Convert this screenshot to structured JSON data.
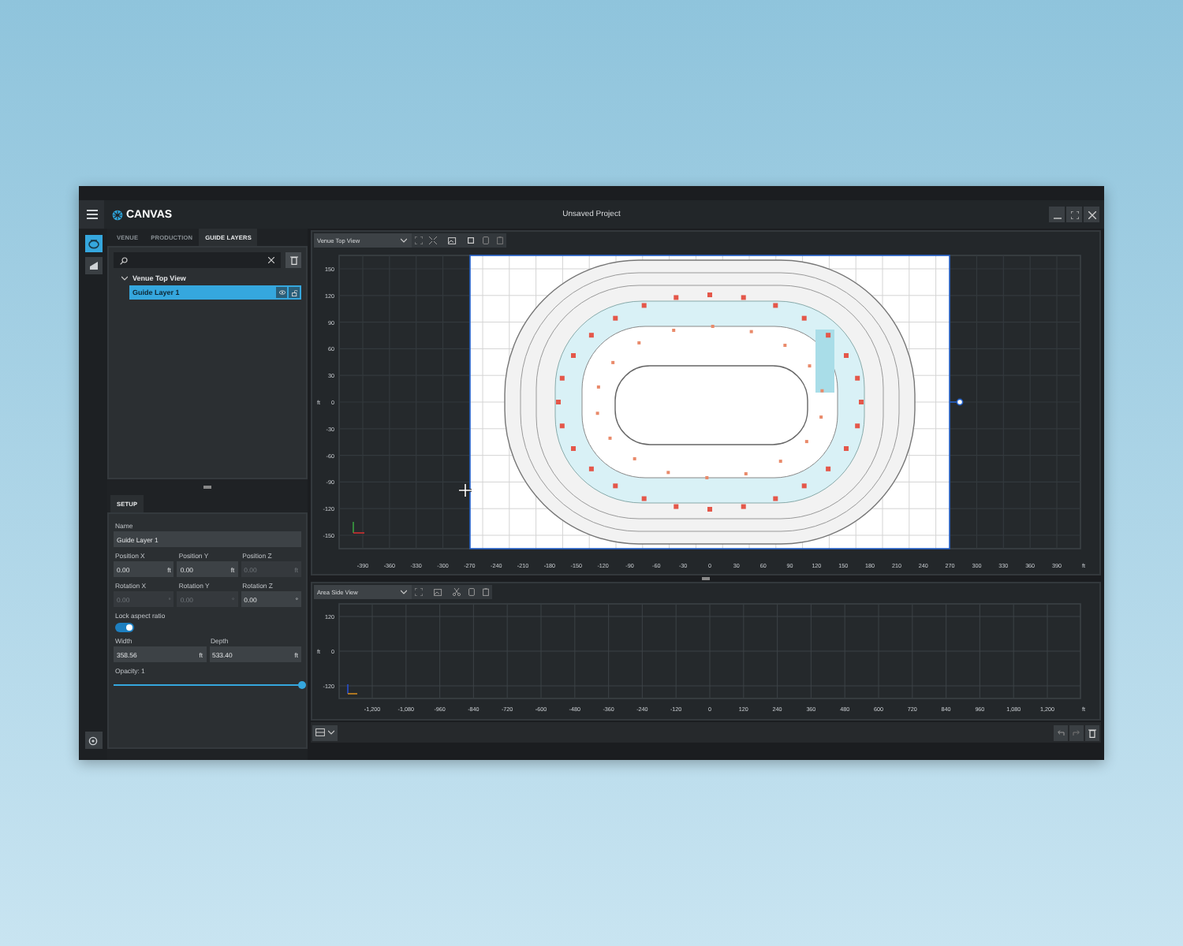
{
  "app": {
    "logo": "CANVAS"
  },
  "window": {
    "title": "Unsaved Project"
  },
  "rail": [
    {
      "kind": "top-view",
      "selected": true
    },
    {
      "kind": "side-view",
      "selected": false
    }
  ],
  "tabs": [
    {
      "label": "VENUE",
      "selected": false
    },
    {
      "label": "PRODUCTION",
      "selected": false
    },
    {
      "label": "GUIDE LAYERS",
      "selected": true
    }
  ],
  "tree": [
    {
      "label": "Venue Top View",
      "expanded": true,
      "children": [
        {
          "label": "Guide Layer 1",
          "selected": true
        }
      ]
    }
  ],
  "setup": {
    "tab": "SETUP",
    "name": {
      "label": "Name",
      "value": "Guide Layer 1"
    },
    "fields": [
      {
        "label": "Position X",
        "value": "0.00",
        "unit": "ft",
        "disabled": false
      },
      {
        "label": "Position Y",
        "value": "0.00",
        "unit": "ft",
        "disabled": false
      },
      {
        "label": "Position Z",
        "value": "0.00",
        "unit": "ft",
        "disabled": true
      },
      {
        "label": "Rotation X",
        "value": "0.00",
        "unit": "°",
        "disabled": true
      },
      {
        "label": "Rotation Y",
        "value": "0.00",
        "unit": "°",
        "disabled": true
      },
      {
        "label": "Rotation Z",
        "value": "0.00",
        "unit": "°",
        "disabled": false
      }
    ],
    "lock": {
      "label": "Lock aspect ratio",
      "on": true
    },
    "size_fields": [
      {
        "label": "Width",
        "value": "358.56",
        "unit": "ft"
      },
      {
        "label": "Depth",
        "value": "533.40",
        "unit": "ft"
      }
    ],
    "opacity": {
      "label": "Opacity: 1",
      "level": 1
    }
  },
  "top_view": {
    "view": "Venue Top View",
    "x_unit": "ft",
    "y_unit": "ft",
    "x_ticks": [
      "-390",
      "-360",
      "-330",
      "-300",
      "-270",
      "-240",
      "-210",
      "-180",
      "-150",
      "-120",
      "-90",
      "-60",
      "-30",
      "0",
      "30",
      "60",
      "90",
      "120",
      "150",
      "180",
      "210",
      "240",
      "270",
      "300",
      "330",
      "360",
      "390"
    ],
    "y_ticks": [
      "150",
      "120",
      "90",
      "60",
      "30",
      "0",
      "-30",
      "-60",
      "-90",
      "-120",
      "-150"
    ]
  },
  "side_view": {
    "view": "Area Side View",
    "x_unit": "ft",
    "y_unit": "ft",
    "x_ticks": [
      "-1,200",
      "-1,080",
      "-960",
      "-840",
      "-720",
      "-600",
      "-480",
      "-360",
      "-240",
      "-120",
      "0",
      "120",
      "240",
      "360",
      "480",
      "600",
      "720",
      "840",
      "960",
      "1,080",
      "1,200"
    ],
    "y_ticks": [
      "120",
      "0",
      "-120"
    ]
  }
}
